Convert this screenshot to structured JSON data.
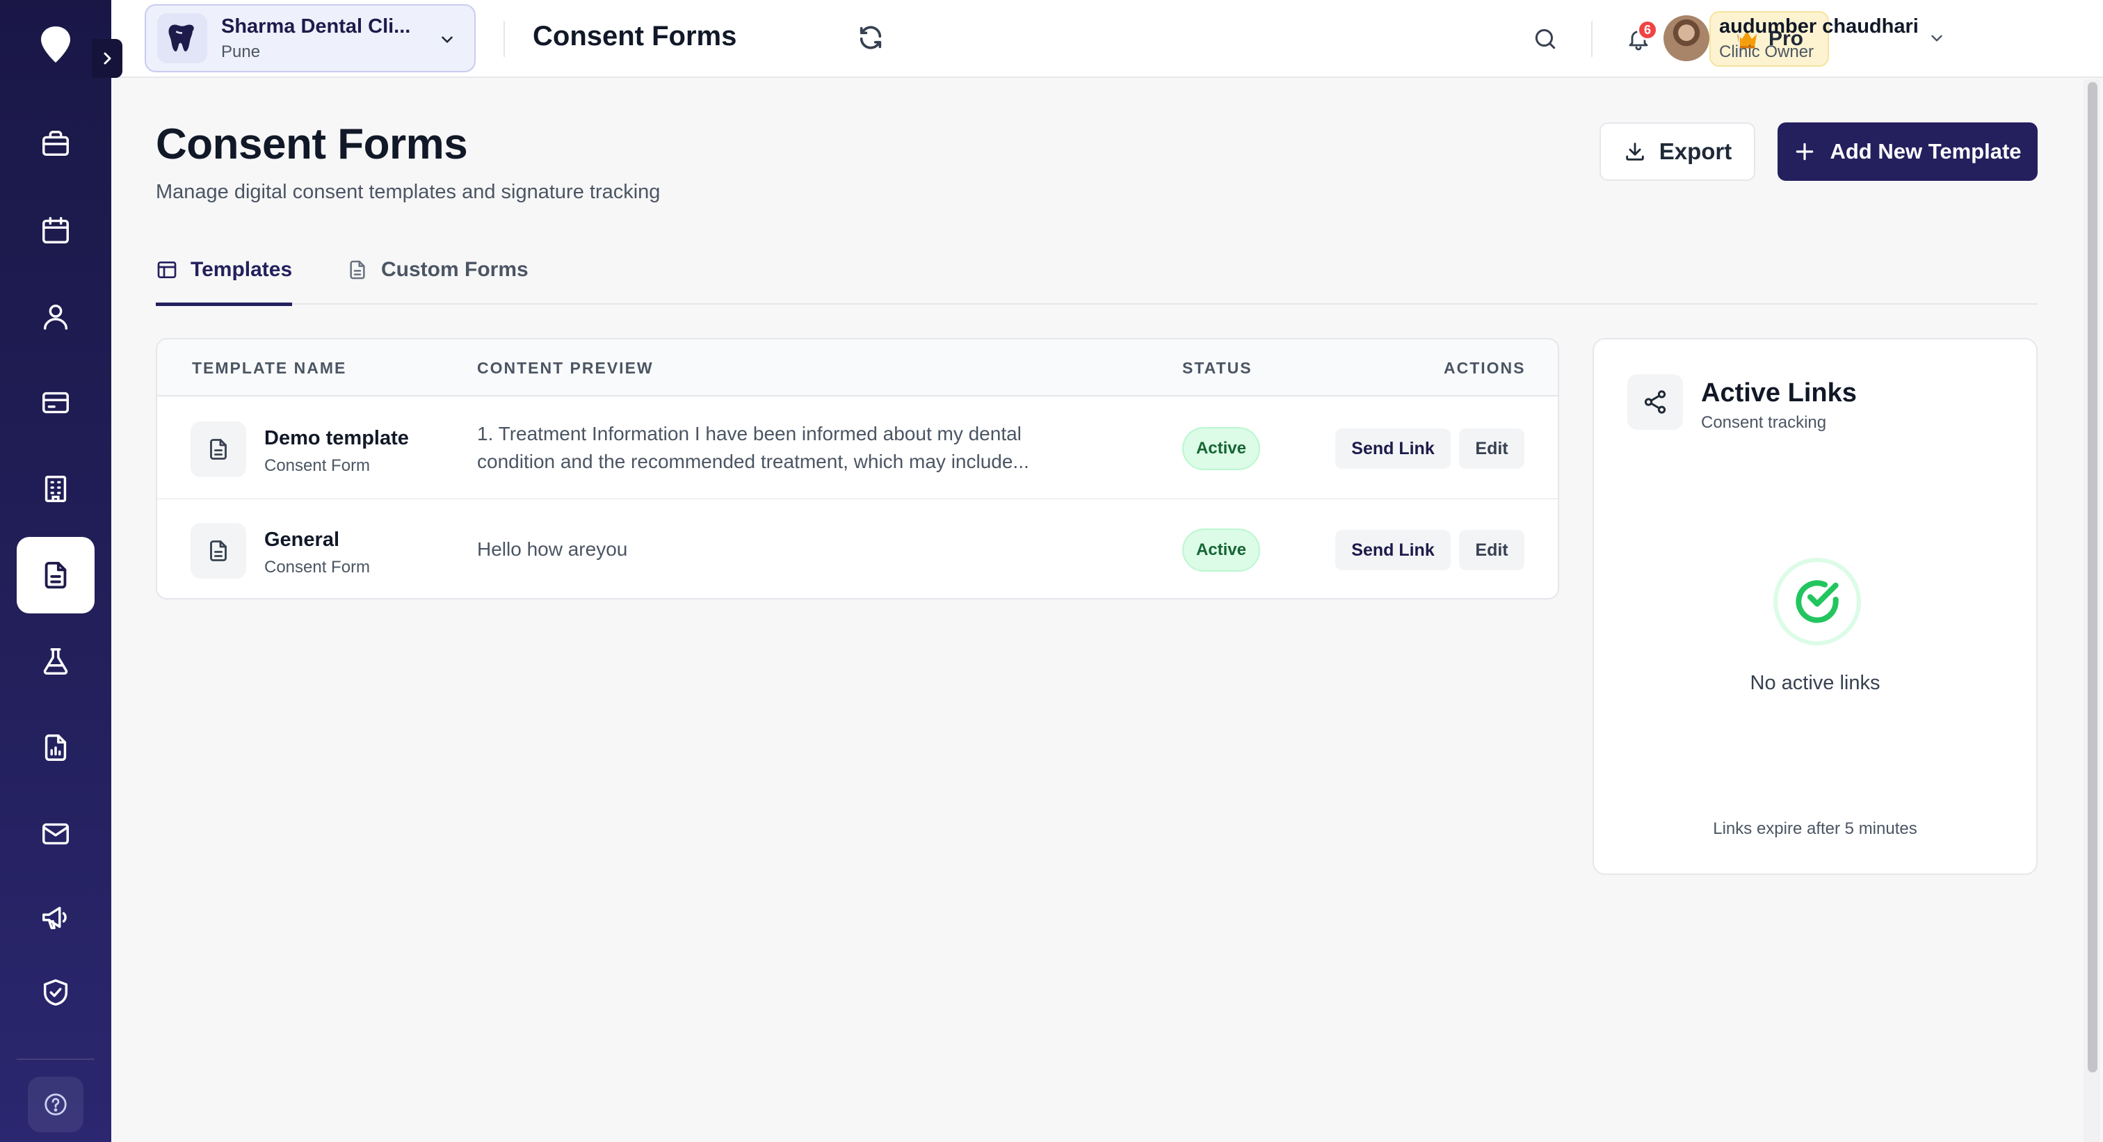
{
  "topbar": {
    "clinic_name": "Sharma Dental Cli...",
    "clinic_city": "Pune",
    "page_heading": "Consent Forms",
    "notification_count": "6",
    "pro_label": "Pro",
    "user_name": "audumber chaudhari",
    "user_role": "Clinic Owner"
  },
  "sidebar": {
    "items": [
      {
        "icon": "briefcase-icon"
      },
      {
        "icon": "calendar-icon"
      },
      {
        "icon": "user-icon"
      },
      {
        "icon": "card-icon"
      },
      {
        "icon": "building-icon"
      },
      {
        "icon": "document-icon",
        "active": true
      },
      {
        "icon": "flask-icon"
      },
      {
        "icon": "chart-document-icon"
      },
      {
        "icon": "mail-icon"
      },
      {
        "icon": "megaphone-icon"
      },
      {
        "icon": "shield-check-icon"
      }
    ]
  },
  "main": {
    "title": "Consent Forms",
    "subtitle": "Manage digital consent templates and signature tracking",
    "export_label": "Export",
    "add_label": "Add New Template",
    "tabs": [
      {
        "label": "Templates",
        "active": true
      },
      {
        "label": "Custom Forms",
        "active": false
      }
    ]
  },
  "table": {
    "headers": [
      "TEMPLATE NAME",
      "CONTENT PREVIEW",
      "STATUS",
      "ACTIONS"
    ],
    "rows": [
      {
        "name": "Demo template",
        "kind": "Consent Form",
        "preview_line1": "1. Treatment Information I have been informed about my dental",
        "preview_line2": "condition and the recommended treatment, which may include...",
        "status": "Active",
        "send_label": "Send Link",
        "edit_label": "Edit"
      },
      {
        "name": "General",
        "kind": "Consent Form",
        "preview_line1": "Hello how areyou",
        "status": "Active",
        "send_label": "Send Link",
        "edit_label": "Edit"
      }
    ]
  },
  "links_panel": {
    "title": "Active Links",
    "subtitle": "Consent tracking",
    "empty_text": "No active links",
    "footer": "Links expire after 5 minutes"
  },
  "colors": {
    "sidebar": "#1a1747",
    "accent": "#24205e",
    "active_badge_bg": "#dcfce7",
    "active_badge_text": "#166534",
    "pro_bg": "#fdf3d0",
    "badge_red": "#ef4444"
  }
}
